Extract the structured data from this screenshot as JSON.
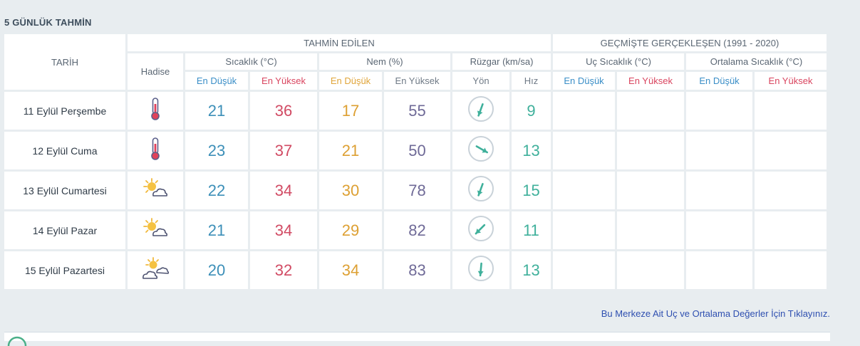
{
  "section_title": "5 GÜNLÜK TAHMİN",
  "headers": {
    "date": "TARİH",
    "predicted": "TAHMİN EDİLEN",
    "past": "GEÇMİŞTE GERÇEKLEŞEN (1991 - 2020)",
    "hadise": "Hadise",
    "temperature": "Sıcaklık (°C)",
    "humidity": "Nem (%)",
    "wind": "Rüzgar (km/sa)",
    "extreme_temp": "Uç Sıcaklık (°C)",
    "avg_temp": "Ortalama Sıcaklık (°C)",
    "min": "En Düşük",
    "max": "En Yüksek",
    "direction": "Yön",
    "speed": "Hız"
  },
  "rows": [
    {
      "date": "11 Eylül Perşembe",
      "icon": "thermometer-icon",
      "tmin": "21",
      "tmax": "36",
      "hmin": "17",
      "hmax": "55",
      "wind_deg": 200,
      "speed": "9"
    },
    {
      "date": "12 Eylül Cuma",
      "icon": "thermometer-icon",
      "tmin": "23",
      "tmax": "37",
      "hmin": "21",
      "hmax": "50",
      "wind_deg": 120,
      "speed": "13"
    },
    {
      "date": "13 Eylül Cumartesi",
      "icon": "partly-cloudy-icon",
      "tmin": "22",
      "tmax": "34",
      "hmin": "30",
      "hmax": "78",
      "wind_deg": 200,
      "speed": "15"
    },
    {
      "date": "14 Eylül Pazar",
      "icon": "partly-cloudy-icon",
      "tmin": "21",
      "tmax": "34",
      "hmin": "29",
      "hmax": "82",
      "wind_deg": 225,
      "speed": "11"
    },
    {
      "date": "15 Eylül Pazartesi",
      "icon": "sun-clouds-icon",
      "tmin": "20",
      "tmax": "32",
      "hmin": "34",
      "hmax": "83",
      "wind_deg": 185,
      "speed": "13"
    }
  ],
  "link_text": "Bu Merkeze Ait Uç ve Ortalama Değerler İçin Tıklayınız.",
  "colors": {
    "min_temp": "#3c8fb8",
    "max_temp": "#d14a63",
    "min_humidity": "#dda033",
    "max_humidity": "#6f6a97",
    "wind_speed": "#3fb09b",
    "wind_arrow": "#3fb09b"
  }
}
